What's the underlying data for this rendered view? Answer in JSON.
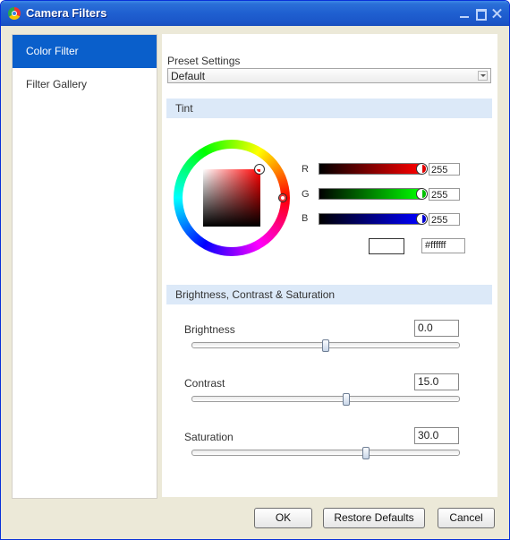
{
  "window": {
    "title": "Camera Filters"
  },
  "sidebar": {
    "items": [
      {
        "label": "Color Filter",
        "selected": true
      },
      {
        "label": "Filter Gallery",
        "selected": false
      }
    ]
  },
  "preset": {
    "label": "Preset Settings",
    "value": "Default"
  },
  "tint": {
    "header": "Tint",
    "channels": [
      {
        "label": "R",
        "value": "255",
        "color": "#ff0000"
      },
      {
        "label": "G",
        "value": "255",
        "color": "#00ff00"
      },
      {
        "label": "B",
        "value": "255",
        "color": "#0000ff"
      }
    ],
    "hex": "#ffffff",
    "swatch_color": "#ffffff"
  },
  "bcs": {
    "header": "Brightness, Contrast & Saturation",
    "sliders": [
      {
        "label": "Brightness",
        "value": "0.0",
        "position": 0.5
      },
      {
        "label": "Contrast",
        "value": "15.0",
        "position": 0.575
      },
      {
        "label": "Saturation",
        "value": "30.0",
        "position": 0.65
      }
    ]
  },
  "buttons": {
    "ok": "OK",
    "restore": "Restore Defaults",
    "cancel": "Cancel"
  },
  "colors": {
    "title_bar": "#1f5fd0",
    "sidebar_selected": "#0a5fcb",
    "section_header": "#dce9f8",
    "window_bg": "#ece9d8"
  }
}
